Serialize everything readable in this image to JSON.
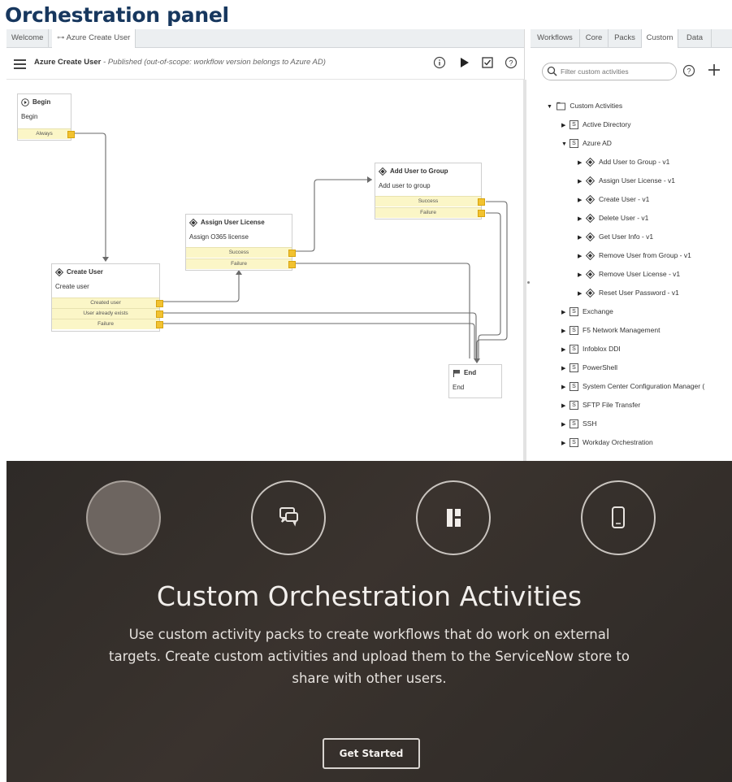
{
  "header": {
    "title": "Orchestration panel"
  },
  "left_tabs": [
    {
      "label": "Welcome"
    },
    {
      "label": "Azure Create User"
    }
  ],
  "workflow": {
    "name": "Azure Create User",
    "status": "- Published",
    "note": "(out-of-scope: workflow version belongs to Azure AD)"
  },
  "nodes": {
    "begin": {
      "title": "Begin",
      "sub": "Begin",
      "conds": [
        "Always"
      ]
    },
    "create_user": {
      "title": "Create User",
      "sub": "Create user",
      "conds": [
        "Created user",
        "User already exists",
        "Failure"
      ]
    },
    "assign_license": {
      "title": "Assign User License",
      "sub": "Assign O365 license",
      "conds": [
        "Success",
        "Failure"
      ]
    },
    "add_group": {
      "title": "Add User to Group",
      "sub": "Add user to group",
      "conds": [
        "Success",
        "Failure"
      ]
    },
    "end": {
      "title": "End",
      "sub": "End"
    }
  },
  "right_tabs": [
    {
      "label": "Workflows"
    },
    {
      "label": "Core"
    },
    {
      "label": "Packs"
    },
    {
      "label": "Custom"
    },
    {
      "label": "Data"
    }
  ],
  "filter": {
    "placeholder": "Filter custom activities"
  },
  "tree": {
    "root": "Custom Activities",
    "packs": [
      "Active Directory",
      "Azure AD",
      "Exchange",
      "F5 Network Management",
      "Infoblox DDI",
      "PowerShell",
      "System Center Configuration Manager (",
      "SFTP File Transfer",
      "SSH",
      "Workday Orchestration"
    ],
    "azure_children": [
      "Add User to Group - v1",
      "Assign User License - v1",
      "Create User - v1",
      "Delete User - v1",
      "Get User Info - v1",
      "Remove User from Group - v1",
      "Remove User License - v1",
      "Reset User Password - v1"
    ]
  },
  "banner": {
    "title": "Custom Orchestration Activities",
    "desc_lines": [
      "Use custom activity packs to create workflows that do work on external",
      "targets. Create custom activities and upload them to the ServiceNow store to",
      "share with other users."
    ],
    "button": "Get Started"
  },
  "colors": {
    "header": "#17375e",
    "condition_fill": "#fbf6c7",
    "port": "#f2c230",
    "banner_bg": "#2e2a27"
  }
}
